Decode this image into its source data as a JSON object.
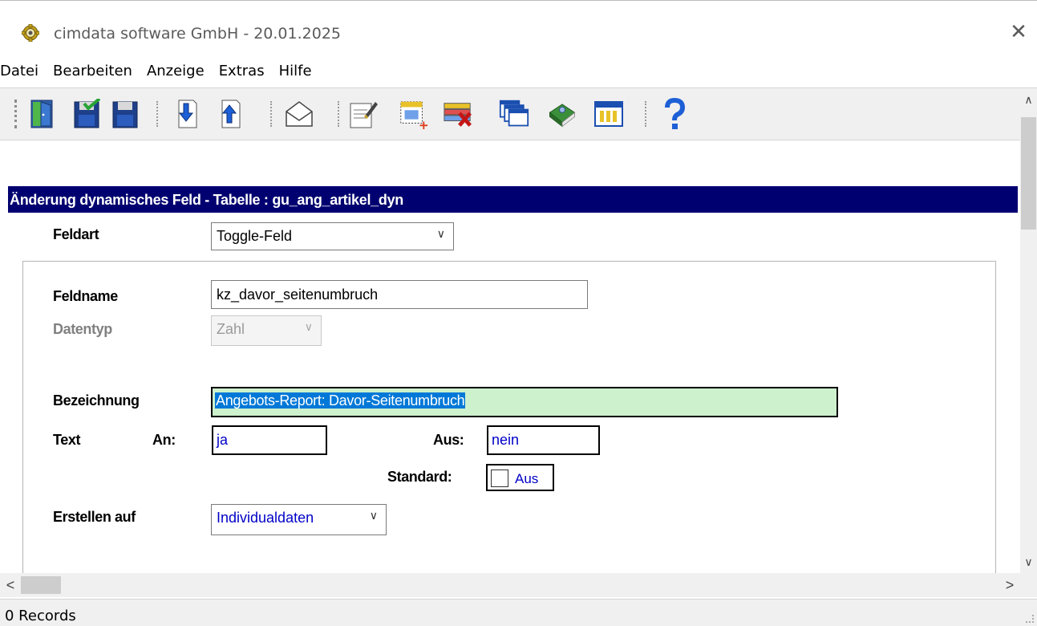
{
  "window": {
    "title": "cimdata software GmbH - 20.01.2025",
    "close_glyph": "✕"
  },
  "menu": {
    "items": [
      "Datei",
      "Bearbeiten",
      "Anzeige",
      "Extras",
      "Hilfe"
    ]
  },
  "toolbar": {
    "icons": [
      "exit-icon",
      "save-check-icon",
      "save-icon",
      "download-icon",
      "upload-icon",
      "mail-icon",
      "edit-document-icon",
      "new-record-icon",
      "delete-record-icon",
      "windows-icon",
      "book-icon",
      "table-icon",
      "help-icon"
    ]
  },
  "form": {
    "header": "Änderung dynamisches Feld - Tabelle : gu_ang_artikel_dyn",
    "feldart_label": "Feldart",
    "feldart_value": "Toggle-Feld",
    "feldname_label": "Feldname",
    "feldname_value": "kz_davor_seitenumbruch",
    "datentyp_label": "Datentyp",
    "datentyp_value": "Zahl",
    "bezeichnung_label": "Bezeichnung",
    "bezeichnung_value": "Angebots-Report: Davor-Seitenumbruch",
    "text_label": "Text",
    "an_label": "An:",
    "an_value": "ja",
    "aus_label": "Aus:",
    "aus_value": "nein",
    "standard_label": "Standard:",
    "standard_checkbox_label": "Aus",
    "standard_checked": false,
    "erstellen_label": "Erstellen auf",
    "erstellen_value": "Individualdaten"
  },
  "status": {
    "records": "0 Records"
  },
  "colors": {
    "header_bg": "#000070",
    "highlight_field_bg": "#cdf0cd",
    "selection_bg": "#0078d7",
    "value_blue": "#0000c8"
  }
}
